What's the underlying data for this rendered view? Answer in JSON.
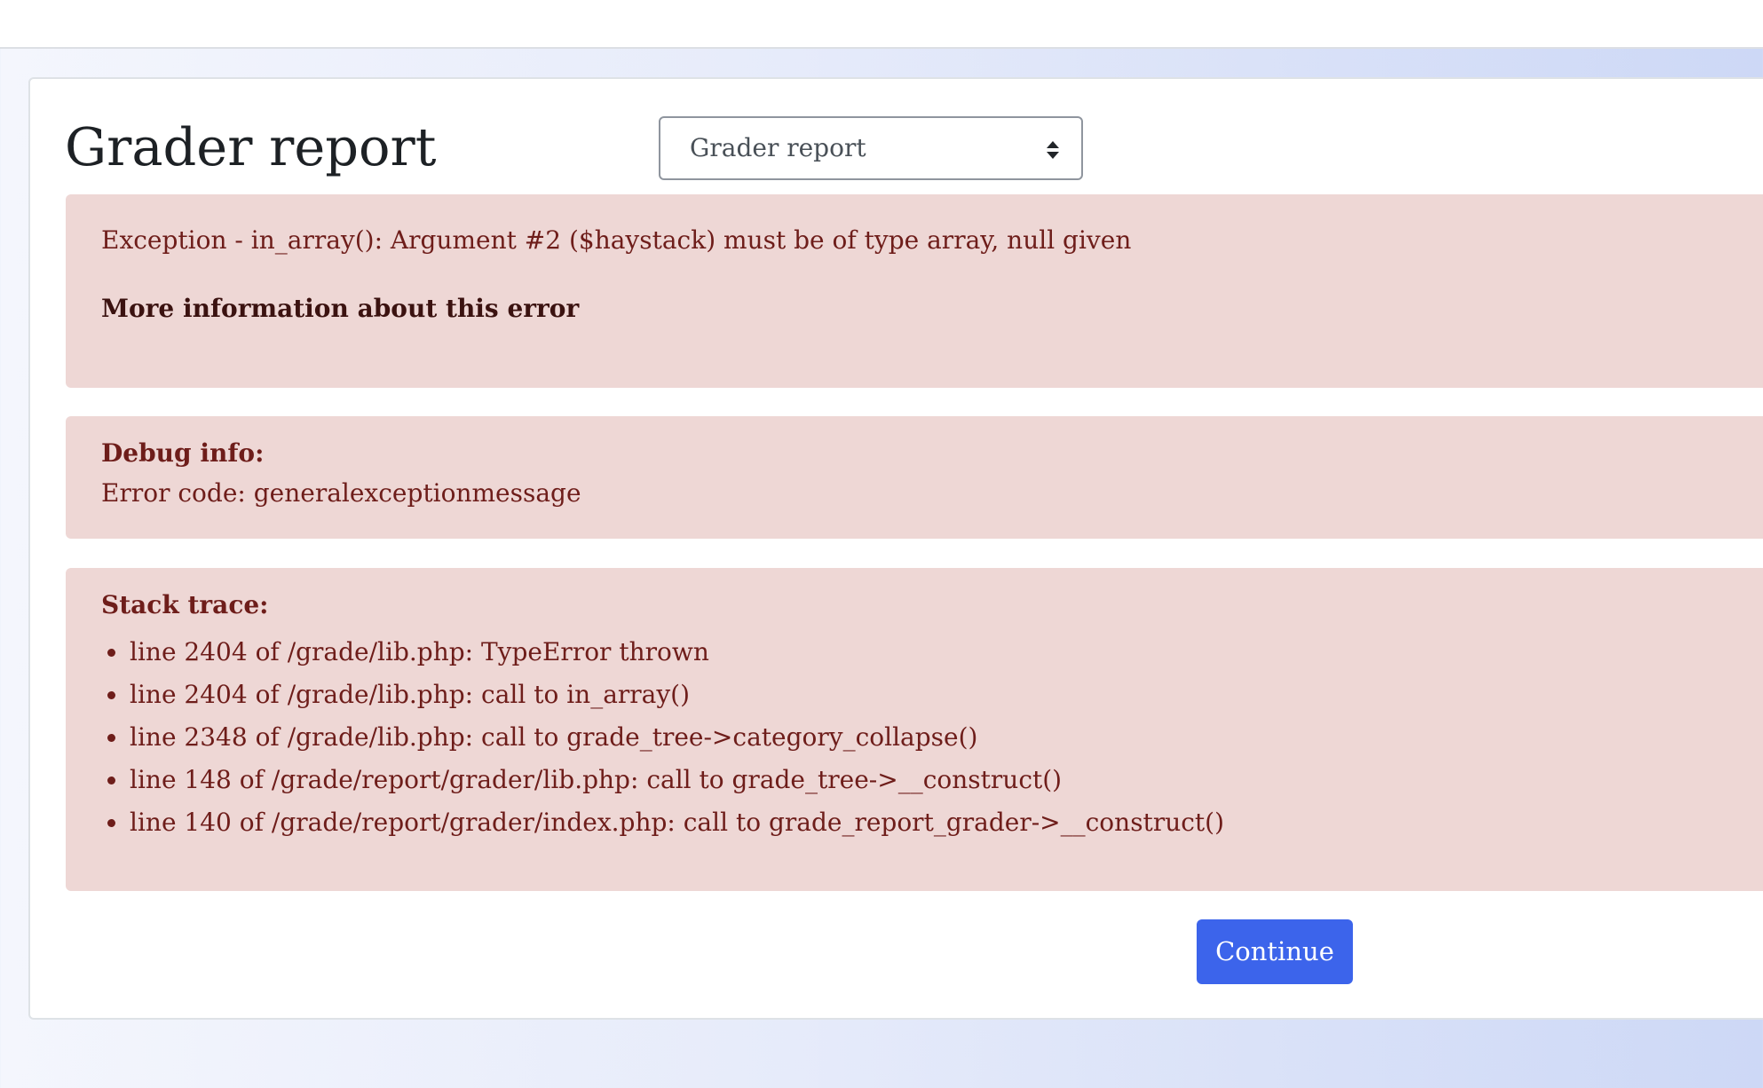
{
  "page": {
    "title": "Grader report"
  },
  "report_selector": {
    "selected": "Grader report",
    "icon": "sort-arrows-icon"
  },
  "error": {
    "message": "Exception - in_array(): Argument #2 ($haystack) must be of type array, null given",
    "more_info_link": "More information about this error"
  },
  "debug": {
    "heading": "Debug info:",
    "error_code": "Error code: generalexceptionmessage"
  },
  "stack_trace": {
    "heading": "Stack trace:",
    "items": [
      "line 2404 of /grade/lib.php: TypeError thrown",
      "line 2404 of /grade/lib.php: call to in_array()",
      "line 2348 of /grade/lib.php: call to grade_tree->category_collapse()",
      "line 148 of /grade/report/grader/lib.php: call to grade_tree->__construct()",
      "line 140 of /grade/report/grader/index.php: call to grade_report_grader->__construct()"
    ]
  },
  "actions": {
    "continue_label": "Continue"
  },
  "colors": {
    "alert_background": "#eed7d5",
    "alert_text": "#6e1d1a",
    "primary_button": "#3c64eb"
  }
}
